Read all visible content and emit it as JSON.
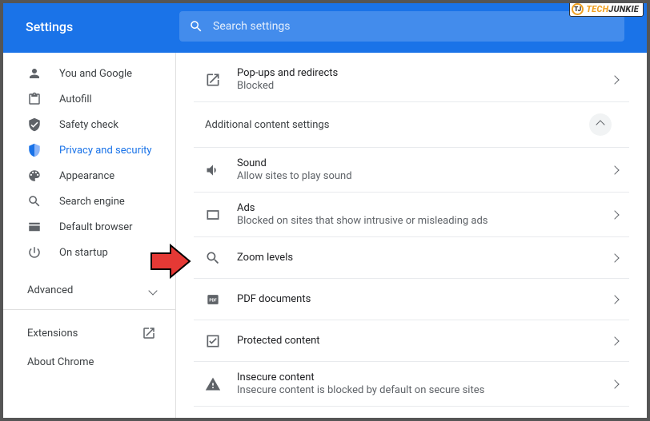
{
  "header": {
    "title": "Settings",
    "search_placeholder": "Search settings"
  },
  "sidebar": {
    "items": [
      {
        "label": "You and Google"
      },
      {
        "label": "Autofill"
      },
      {
        "label": "Safety check"
      },
      {
        "label": "Privacy and security"
      },
      {
        "label": "Appearance"
      },
      {
        "label": "Search engine"
      },
      {
        "label": "Default browser"
      },
      {
        "label": "On startup"
      }
    ],
    "advanced": "Advanced",
    "footer": [
      {
        "label": "Extensions"
      },
      {
        "label": "About Chrome"
      }
    ]
  },
  "content": {
    "popups": {
      "title": "Pop-ups and redirects",
      "sub": "Blocked"
    },
    "section_header": "Additional content settings",
    "rows": [
      {
        "title": "Sound",
        "sub": "Allow sites to play sound"
      },
      {
        "title": "Ads",
        "sub": "Blocked on sites that show intrusive or misleading ads"
      },
      {
        "title": "Zoom levels",
        "sub": ""
      },
      {
        "title": "PDF documents",
        "sub": ""
      },
      {
        "title": "Protected content",
        "sub": ""
      },
      {
        "title": "Insecure content",
        "sub": "Insecure content is blocked by default on secure sites"
      }
    ]
  },
  "watermark": {
    "part1": "TECH",
    "part2": "JUNKIE",
    "badge": "TJ"
  }
}
